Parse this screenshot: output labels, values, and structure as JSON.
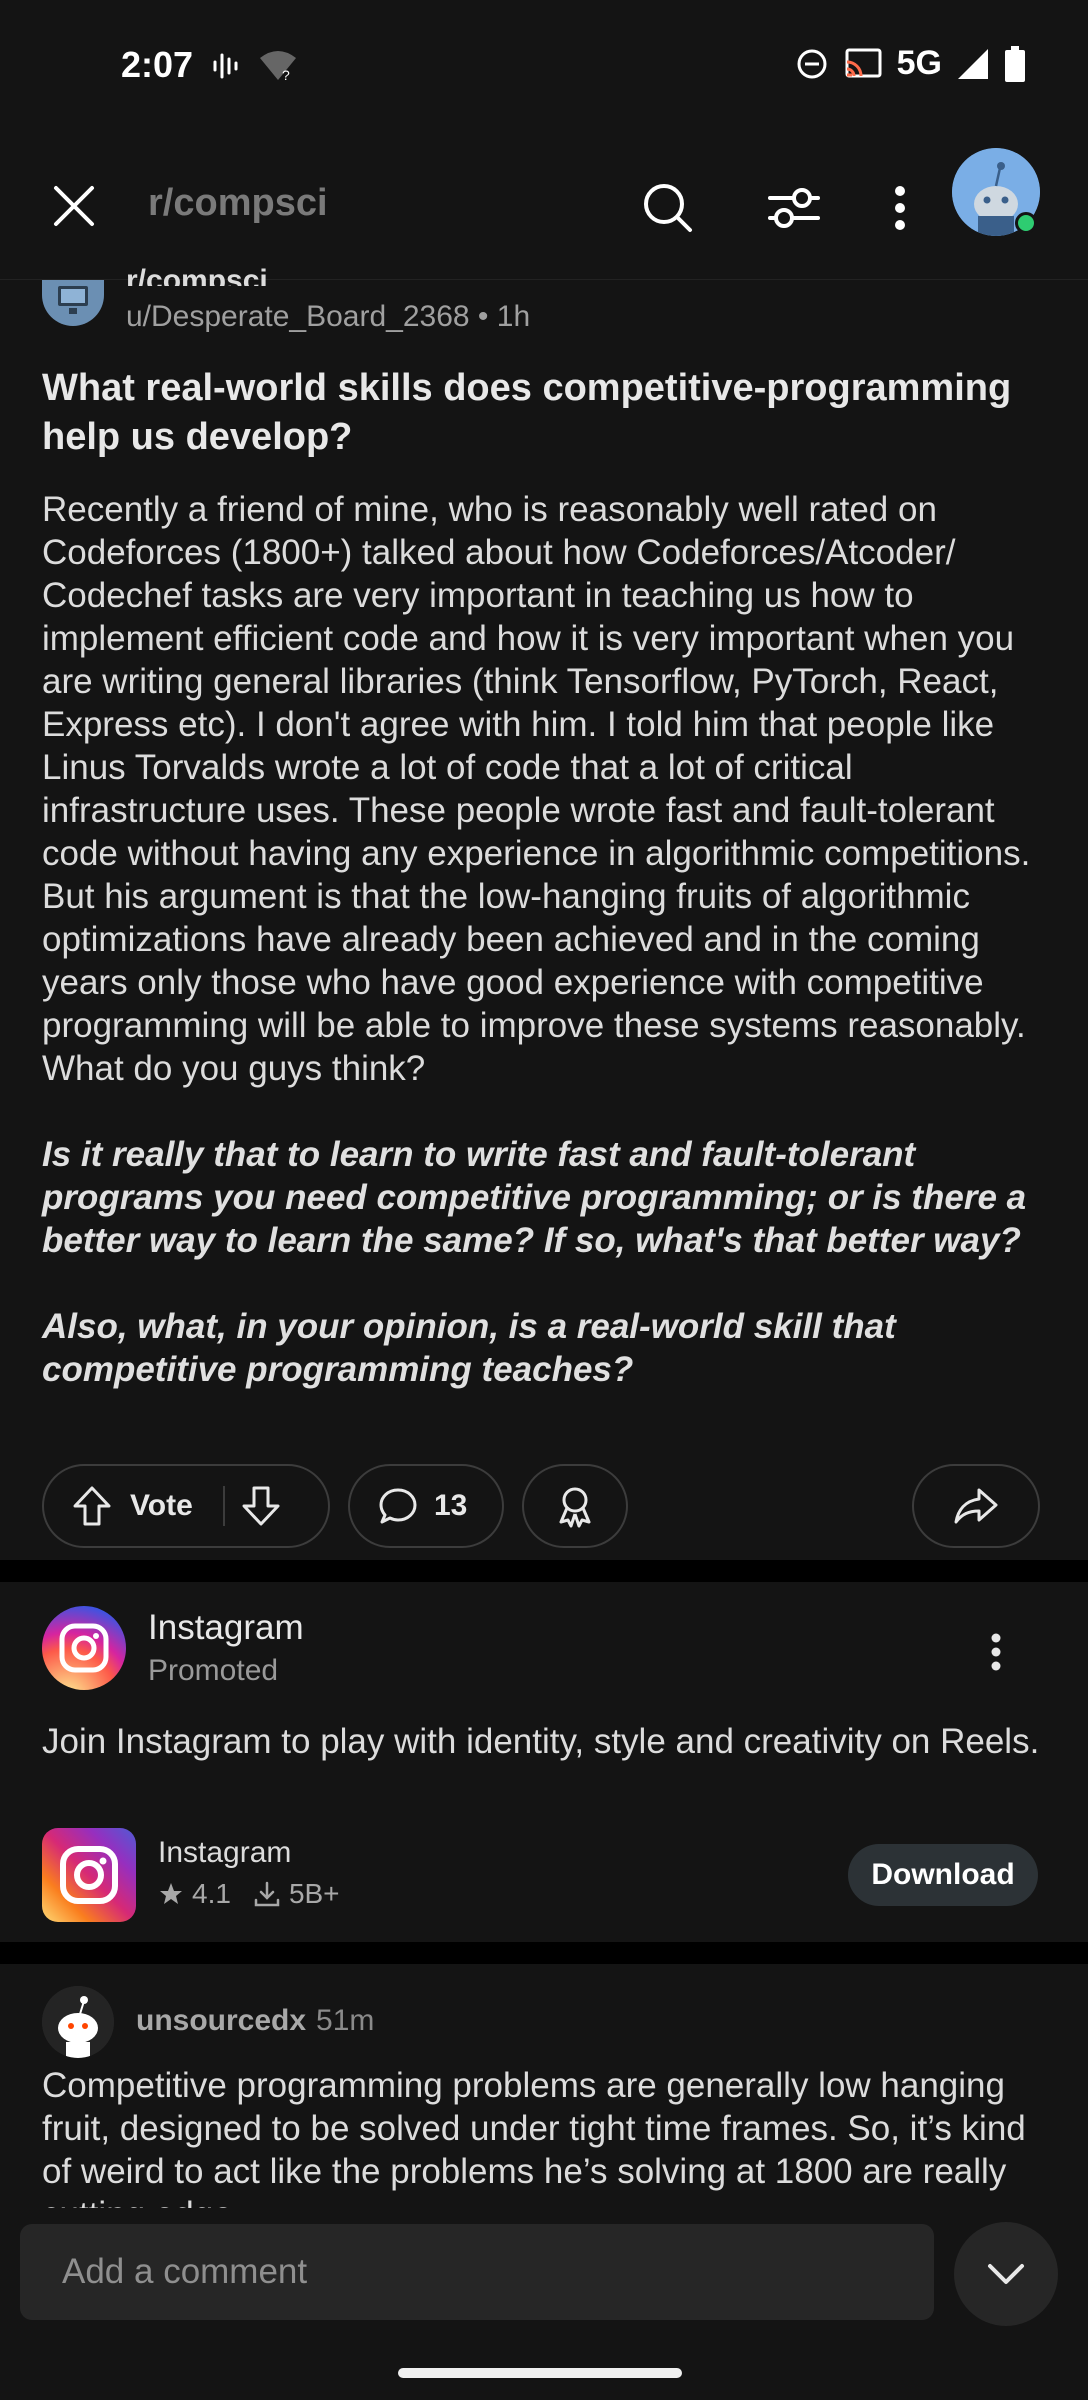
{
  "status_bar": {
    "time": "2:07",
    "network": "5G",
    "icons": [
      "voice-icon",
      "wifi-question-icon",
      "dnd-icon",
      "cast-icon",
      "signal-icon",
      "battery-icon"
    ]
  },
  "app_bar": {
    "subreddit": "r/compsci",
    "icons": [
      "close-icon",
      "search-icon",
      "filter-icon",
      "more-vertical-icon"
    ]
  },
  "post": {
    "subreddit_cut": "r/compsci",
    "author": "u/Desperate_Board_2368",
    "time": "1h",
    "meta": "u/Desperate_Board_2368 • 1h",
    "title": "What real-world skills does competitive-programming help us develop?",
    "body": [
      "Recently a friend of mine, who is reasonably well rated on Codeforces (1800+) talked about how Codeforces/Atcoder/ Codechef tasks are very important in teaching us how to implement efficient code and how it is very important when you are writing general libraries (think Tensorflow, PyTorch, React, Express etc). I don't agree with him. I told him that people like Linus Torvalds wrote a lot of code that a lot of critical infrastructure uses. These people wrote fast and fault-tolerant code without having any experience in algorithmic competitions. But his argument is that the low-hanging fruits of algorithmic optimizations have already been achieved and in the coming years only those who have good experience with competitive programming will be able to improve these systems reasonably. What do you guys think?",
      "Is it really that to learn to write fast and fault-tolerant programs you need competitive programming; or is there a better way to learn the same? If so, what's that better way?",
      "Also, what, in your opinion, is a real-world skill that competitive programming teaches?"
    ],
    "vote_label": "Vote",
    "comment_count": "13"
  },
  "ad": {
    "name": "Instagram",
    "promoted": "Promoted",
    "text": "Join Instagram to play with identity, style and creativity on Reels.",
    "app_name": "Instagram",
    "rating": "4.1",
    "downloads": "5B+",
    "cta": "Download"
  },
  "comment": {
    "user": "unsourcedx",
    "time": "51m",
    "text": "Competitive programming problems are generally low hanging fruit, designed to be solved under tight time frames. So, it’s kind of weird to act like the problems he’s solving at 1800 are really cutting edge."
  },
  "comment_bar": {
    "placeholder": "Add a comment"
  },
  "colors": {
    "background": "#141414",
    "separator": "#000000",
    "online": "#2ecc71",
    "avatar": "#6fa6e0"
  }
}
